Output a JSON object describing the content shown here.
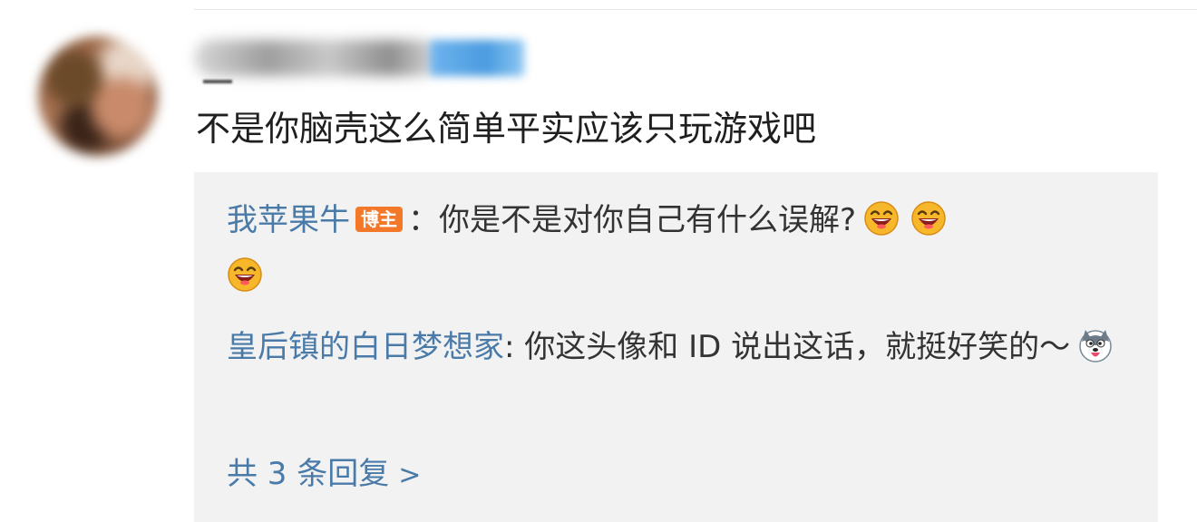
{
  "comment": {
    "text": "不是你脑壳这么简单平实应该只玩游戏吧"
  },
  "replies": [
    {
      "author": "我苹果牛",
      "badge": "博主",
      "separator": "：",
      "text": "你是不是对你自己有什么误解?",
      "emojis": [
        "laughing-face-icon",
        "laughing-face-icon",
        "laughing-face-icon"
      ]
    },
    {
      "author": "皇后镇的白日梦想家",
      "separator": ": ",
      "text": "你这头像和 ID 说出这话，就挺好笑的～",
      "emojis": [
        "husky-dog-icon"
      ]
    }
  ],
  "more_replies": {
    "label": "共 3 条回复",
    "chevron": ">"
  },
  "colors": {
    "link": "#4a7ba8",
    "reply_background": "#f2f2f2",
    "badge": "#f3782a",
    "text": "#1f1f1f"
  }
}
